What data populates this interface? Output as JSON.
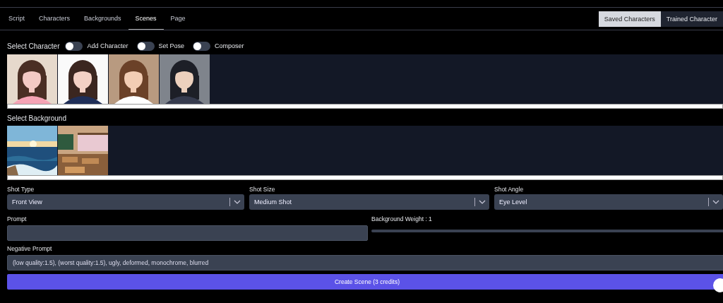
{
  "tabs": [
    {
      "label": "Script",
      "selected": false
    },
    {
      "label": "Characters",
      "selected": false
    },
    {
      "label": "Backgrounds",
      "selected": false
    },
    {
      "label": "Scenes",
      "selected": true
    },
    {
      "label": "Page",
      "selected": false
    }
  ],
  "source_buttons": [
    {
      "label": "Saved Characters",
      "selected": true
    },
    {
      "label": "Trained Character",
      "selected": false
    }
  ],
  "character_section": {
    "title": "Select Character",
    "toggles": [
      {
        "label": "Add Character",
        "on": false
      },
      {
        "label": "Set Pose",
        "on": false
      },
      {
        "label": "Composer",
        "on": false
      }
    ]
  },
  "background_section": {
    "title": "Select Background"
  },
  "selects": [
    {
      "label": "Shot Type",
      "value": "Front View"
    },
    {
      "label": "Shot Size",
      "value": "Medium Shot"
    },
    {
      "label": "Shot Angle",
      "value": "Eye Level"
    }
  ],
  "prompt": {
    "label": "Prompt"
  },
  "background_weight": {
    "label": "Background Weight : 1"
  },
  "negative_prompt": {
    "label": "Negative Prompt",
    "value": "(low quality:1.5), (worst quality:1.5), ugly, deformed, monochrome, blurred"
  },
  "create_button": {
    "label": "Create Scene (3 credits)"
  }
}
